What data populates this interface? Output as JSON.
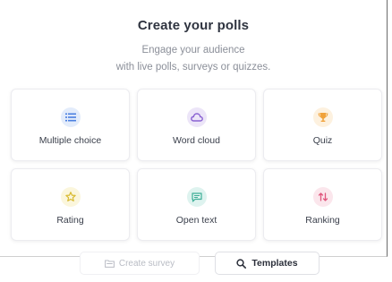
{
  "header": {
    "title": "Create your polls",
    "subtitle_line1": "Engage your audience",
    "subtitle_line2": "with live polls, surveys or quizzes."
  },
  "cards": [
    {
      "label": "Multiple choice",
      "icon": "list-icon",
      "bg": "#e3ecfb",
      "fg": "#4a7fe0"
    },
    {
      "label": "Word cloud",
      "icon": "cloud-icon",
      "bg": "#ece5f8",
      "fg": "#8a63d2"
    },
    {
      "label": "Quiz",
      "icon": "trophy-icon",
      "bg": "#fdf1df",
      "fg": "#f0a23b"
    },
    {
      "label": "Rating",
      "icon": "star-icon",
      "bg": "#fbf6dc",
      "fg": "#d8b92e"
    },
    {
      "label": "Open text",
      "icon": "chat-icon",
      "bg": "#def3ef",
      "fg": "#3fae98"
    },
    {
      "label": "Ranking",
      "icon": "sort-arrows-icon",
      "bg": "#fbe6ec",
      "fg": "#e0577e"
    }
  ],
  "actions": {
    "create_survey_label": "Create survey",
    "templates_label": "Templates"
  }
}
